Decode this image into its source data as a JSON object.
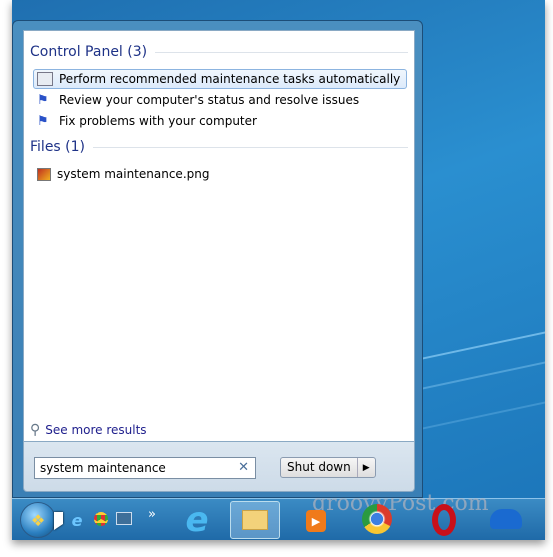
{
  "start_menu": {
    "groups": [
      {
        "title": "Control Panel (3)",
        "items": [
          {
            "label": "Perform recommended maintenance tasks automatically",
            "icon": "action-center-icon",
            "selected": true
          },
          {
            "label": "Review your computer's status and resolve issues",
            "icon": "flag-icon"
          },
          {
            "label": "Fix problems with your computer",
            "icon": "flag-icon"
          }
        ]
      },
      {
        "title": "Files (1)",
        "items": [
          {
            "label": "system maintenance.png",
            "icon": "image-file-icon"
          }
        ]
      }
    ],
    "see_more": "See more results",
    "search_value": "system maintenance",
    "shutdown_label": "Shut down"
  },
  "taskbar": {
    "watermark": "groovyPost.com",
    "overflow": "»",
    "apps": [
      "internet-explorer",
      "file-explorer",
      "media-player",
      "chrome",
      "opera",
      "skydrive"
    ]
  }
}
